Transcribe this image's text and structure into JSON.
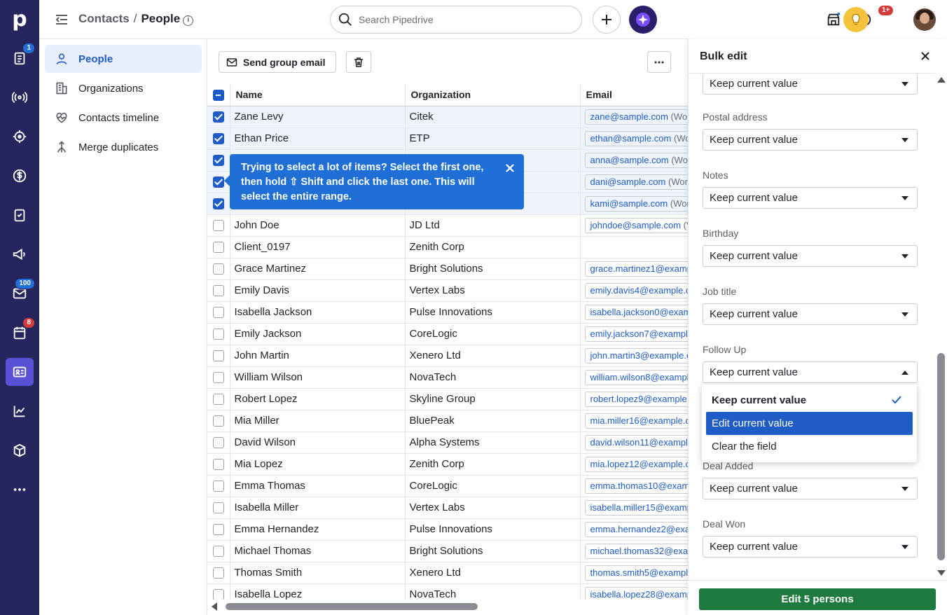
{
  "app": {
    "logo_letter": "p"
  },
  "rail": {
    "badges": {
      "activities": "1",
      "mail": "100",
      "calendar": "8"
    }
  },
  "header": {
    "crumb_parent": "Contacts",
    "crumb_sep": "/",
    "crumb_current": "People",
    "search_placeholder": "Search Pipedrive",
    "notif_badge": "1+"
  },
  "sidebar": {
    "items": [
      {
        "label": "People"
      },
      {
        "label": "Organizations"
      },
      {
        "label": "Contacts timeline"
      },
      {
        "label": "Merge duplicates"
      }
    ]
  },
  "toolbar": {
    "send_group_email": "Send group email"
  },
  "table": {
    "headers": {
      "name": "Name",
      "organization": "Organization",
      "email": "Email"
    },
    "rows": [
      {
        "name": "Zane Levy",
        "org": "Citek",
        "email": "zane@sample.com",
        "type": "(Wor",
        "checked": true
      },
      {
        "name": "Ethan Price",
        "org": "ETP",
        "email": "ethan@sample.com",
        "type": "(Wo",
        "checked": true
      },
      {
        "name": "",
        "org": "",
        "email": "anna@sample.com",
        "type": "(Wor",
        "checked": true
      },
      {
        "name": "",
        "org": "",
        "email": "dani@sample.com",
        "type": "(Wor",
        "checked": true
      },
      {
        "name": "",
        "org": "",
        "email": "kami@sample.com",
        "type": "(Wor",
        "checked": true
      },
      {
        "name": "John Doe",
        "org": "JD Ltd",
        "email": "johndoe@sample.com",
        "type": "(V",
        "checked": false
      },
      {
        "name": "Client_0197",
        "org": "Zenith Corp",
        "email": "",
        "type": "",
        "checked": false
      },
      {
        "name": "Grace Martinez",
        "org": "Bright Solutions",
        "email": "grace.martinez1@examp",
        "type": "",
        "checked": false
      },
      {
        "name": "Emily Davis",
        "org": "Vertex Labs",
        "email": "emily.davis4@example.c",
        "type": "",
        "checked": false
      },
      {
        "name": "Isabella Jackson",
        "org": "Pulse Innovations",
        "email": "isabella.jackson0@exam",
        "type": "",
        "checked": false
      },
      {
        "name": "Emily Jackson",
        "org": "CoreLogic",
        "email": "emily.jackson7@example",
        "type": "",
        "checked": false
      },
      {
        "name": "John Martin",
        "org": "Xenero Ltd",
        "email": "john.martin3@example.c",
        "type": "",
        "checked": false
      },
      {
        "name": "William Wilson",
        "org": "NovaTech",
        "email": "william.wilson8@exampl",
        "type": "",
        "checked": false
      },
      {
        "name": "Robert Lopez",
        "org": "Skyline Group",
        "email": "robert.lopez9@example.",
        "type": "",
        "checked": false
      },
      {
        "name": "Mia Miller",
        "org": "BluePeak",
        "email": "mia.miller16@example.co",
        "type": "",
        "checked": false
      },
      {
        "name": "David Wilson",
        "org": "Alpha Systems",
        "email": "david.wilson11@example",
        "type": "",
        "checked": false
      },
      {
        "name": "Mia Lopez",
        "org": "Zenith Corp",
        "email": "mia.lopez12@example.co",
        "type": "",
        "checked": false
      },
      {
        "name": "Emma Thomas",
        "org": "CoreLogic",
        "email": "emma.thomas10@examp",
        "type": "",
        "checked": false
      },
      {
        "name": "Isabella Miller",
        "org": "Vertex Labs",
        "email": "isabella.miller15@examp",
        "type": "",
        "checked": false
      },
      {
        "name": "Emma Hernandez",
        "org": "Pulse Innovations",
        "email": "emma.hernandez2@exa",
        "type": "",
        "checked": false
      },
      {
        "name": "Michael Thomas",
        "org": "Bright Solutions",
        "email": "michael.thomas32@exar",
        "type": "",
        "checked": false
      },
      {
        "name": "Thomas Smith",
        "org": "Xenero Ltd",
        "email": "thomas.smith5@example",
        "type": "",
        "checked": false
      },
      {
        "name": "Isabella Lopez",
        "org": "NovaTech",
        "email": "isabella.lopez28@examp",
        "type": "",
        "checked": false
      }
    ]
  },
  "tooltip": {
    "text": "Trying to select a lot of items? Select the first one, then hold ⇧ Shift and click the last one. This will select the entire range."
  },
  "bulk_edit": {
    "title": "Bulk edit",
    "fields": [
      {
        "label": "",
        "value": "Keep current value"
      },
      {
        "label": "Postal address",
        "value": "Keep current value"
      },
      {
        "label": "Notes",
        "value": "Keep current value"
      },
      {
        "label": "Birthday",
        "value": "Keep current value"
      },
      {
        "label": "Job title",
        "value": "Keep current value"
      },
      {
        "label": "Follow Up",
        "value": "Keep current value"
      },
      {
        "label": "Deal Added",
        "value": "Keep current value"
      },
      {
        "label": "Deal Won",
        "value": "Keep current value"
      }
    ],
    "dropdown_options": [
      {
        "label": "Keep current value",
        "selected": true
      },
      {
        "label": "Edit current value",
        "highlighted": true
      },
      {
        "label": "Clear the field"
      }
    ],
    "submit_label": "Edit 5 persons"
  },
  "colors": {
    "rail": "#26255d",
    "accent": "#1f5cc5",
    "tooltip": "#1f6fd6",
    "submit": "#1f7a3f"
  }
}
